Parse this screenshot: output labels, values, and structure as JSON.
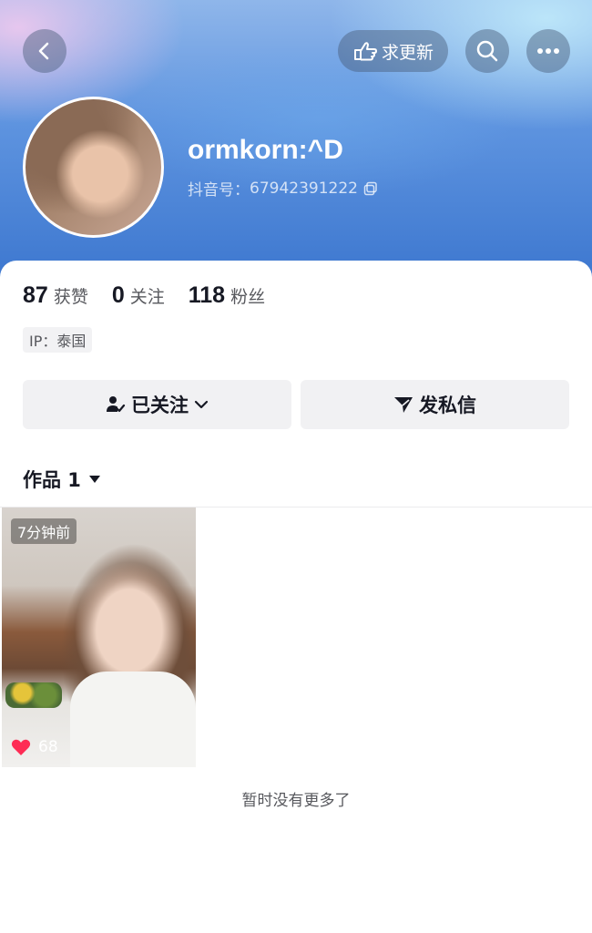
{
  "header": {
    "request_update_label": "求更新",
    "nickname": "ormkorn:^D",
    "douyin_id_label": "抖音号：",
    "douyin_id": "67942391222"
  },
  "stats": {
    "likes_count": "87",
    "likes_label": "获赞",
    "following_count": "0",
    "following_label": "关注",
    "followers_count": "118",
    "followers_label": "粉丝"
  },
  "ip_tag": "IP：泰国",
  "actions": {
    "followed_label": "已关注",
    "message_label": "发私信"
  },
  "works_tab": {
    "label": "作品 1"
  },
  "videos": [
    {
      "time": "7分钟前",
      "likes": "68"
    }
  ],
  "end_text": "暂时没有更多了",
  "colors": {
    "like_heart": "#fe2c55",
    "header_blue": "#5d93df"
  }
}
